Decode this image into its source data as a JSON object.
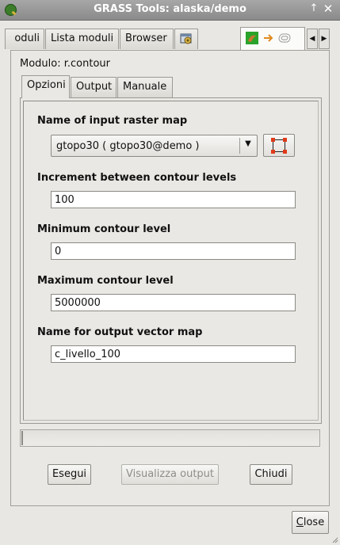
{
  "window": {
    "title": "GRASS Tools: alaska/demo",
    "maximize_glyph": "↑",
    "close_glyph": "✕"
  },
  "top_tabs": {
    "moduli": "oduli",
    "lista": "Lista moduli",
    "browser": "Browser",
    "gear_icon": "module-config-icon",
    "active_icons": [
      "raster-icon",
      "arrow-icon",
      "contour-icon"
    ],
    "scroll_left": "◀",
    "scroll_right": "▶"
  },
  "module": {
    "label": "Modulo: r.contour"
  },
  "inner_tabs": {
    "opzioni": "Opzioni",
    "output": "Output",
    "manuale": "Manuale"
  },
  "form": {
    "raster": {
      "label": "Name of input raster map",
      "value": "gtopo30 ( gtopo30@demo )"
    },
    "increment": {
      "label": "Increment between contour levels",
      "value": "100"
    },
    "minimum": {
      "label": "Minimum contour level",
      "value": "0"
    },
    "maximum": {
      "label": "Maximum contour level",
      "value": "5000000"
    },
    "output_name": {
      "label": "Name for output vector map",
      "value": "c_livello_100"
    }
  },
  "progress": {
    "value": 0
  },
  "buttons": {
    "esegui": "Esegui",
    "visualizza": "Visualizza output",
    "chiudi": "Chiudi",
    "close": "Close"
  },
  "colors": {
    "titlebar": "#8f8f8f",
    "select_corner": "#e03a1a",
    "disabled_text": "#8f8d88"
  }
}
